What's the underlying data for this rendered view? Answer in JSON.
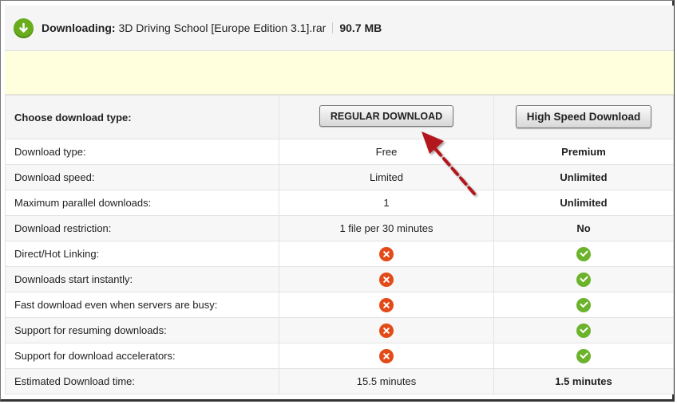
{
  "header": {
    "downloading_label": "Downloading:",
    "file_name": "3D Driving School [Europe Edition 3.1].rar",
    "file_size": "90.7 MB"
  },
  "choose": {
    "label": "Choose download type:",
    "regular_button": "REGULAR DOWNLOAD",
    "high_speed_button": "High Speed Download"
  },
  "rows": [
    {
      "label": "Download type:",
      "free": "Free",
      "premium": "Premium"
    },
    {
      "label": "Download speed:",
      "free": "Limited",
      "premium": "Unlimited"
    },
    {
      "label": "Maximum parallel downloads:",
      "free": "1",
      "premium": "Unlimited"
    },
    {
      "label": "Download restriction:",
      "free": "1 file per 30 minutes",
      "premium": "No"
    },
    {
      "label": "Direct/Hot Linking:",
      "free_icon": "cross-icon",
      "premium_icon": "check-icon"
    },
    {
      "label": "Downloads start instantly:",
      "free_icon": "cross-icon",
      "premium_icon": "check-icon"
    },
    {
      "label": "Fast download even when servers are busy:",
      "free_icon": "cross-icon",
      "premium_icon": "check-icon"
    },
    {
      "label": "Support for resuming downloads:",
      "free_icon": "cross-icon",
      "premium_icon": "check-icon"
    },
    {
      "label": "Support for download accelerators:",
      "free_icon": "cross-icon",
      "premium_icon": "check-icon"
    },
    {
      "label": "Estimated Download time:",
      "free": "15.5 minutes",
      "premium": "1.5 minutes"
    }
  ],
  "colors": {
    "accent_green": "#69ad1c",
    "cross_red": "#e34a18",
    "notice_yellow": "#ffffdd",
    "arrow_red": "#b3141b"
  }
}
